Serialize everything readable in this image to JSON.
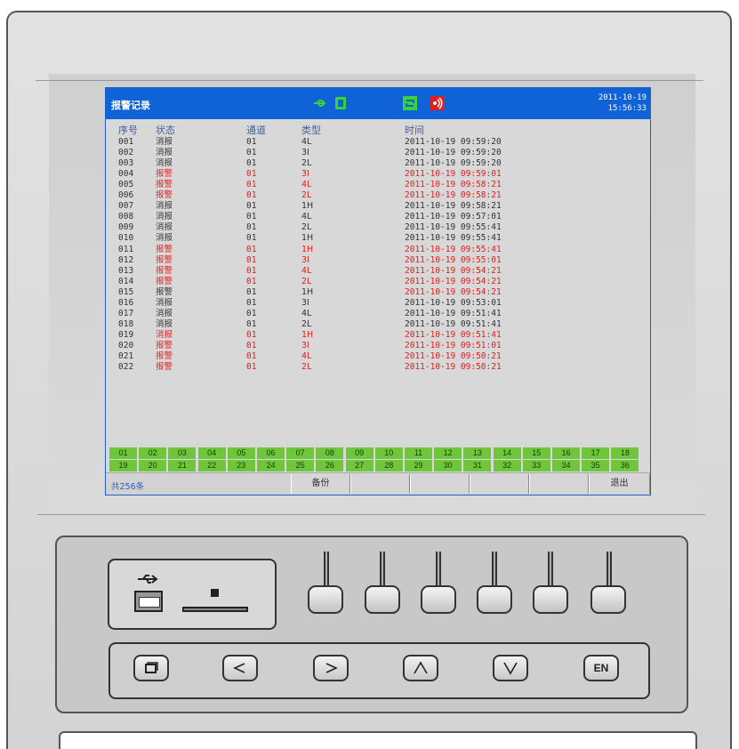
{
  "screen": {
    "title": "报警记录",
    "date": "2011-10-19",
    "time": "15:56:33",
    "headers": {
      "no": "序号",
      "status": "状态",
      "channel": "通道",
      "type": "类型",
      "time": "时间"
    },
    "rows": [
      {
        "no": "001",
        "status": "消报",
        "channel": "01",
        "type": "4L",
        "time": "2011-10-19 09:59:20",
        "color": "black"
      },
      {
        "no": "002",
        "status": "消报",
        "channel": "01",
        "type": "3I",
        "time": "2011-10-19 09:59:20",
        "color": "black"
      },
      {
        "no": "003",
        "status": "消报",
        "channel": "01",
        "type": "2L",
        "time": "2011-10-19 09:59:20",
        "color": "black"
      },
      {
        "no": "004",
        "status": "报警",
        "channel": "01",
        "type": "3I",
        "time": "2011-10-19 09:59:01",
        "color": "red"
      },
      {
        "no": "005",
        "status": "报警",
        "channel": "01",
        "type": "4L",
        "time": "2011-10-19 09:58:21",
        "color": "red"
      },
      {
        "no": "006",
        "status": "报警",
        "channel": "01",
        "type": "2L",
        "time": "2011-10-19 09:58:21",
        "color": "red"
      },
      {
        "no": "007",
        "status": "消报",
        "channel": "01",
        "type": "1H",
        "time": "2011-10-19 09:58:21",
        "color": "black"
      },
      {
        "no": "008",
        "status": "消报",
        "channel": "01",
        "type": "4L",
        "time": "2011-10-19 09:57:01",
        "color": "black"
      },
      {
        "no": "009",
        "status": "消报",
        "channel": "01",
        "type": "2L",
        "time": "2011-10-19 09:55:41",
        "color": "black"
      },
      {
        "no": "010",
        "status": "消报",
        "channel": "01",
        "type": "1H",
        "time": "2011-10-19 09:55:41",
        "color": "black"
      },
      {
        "no": "011",
        "status": "报警",
        "channel": "01",
        "type": "1H",
        "time": "2011-10-19 09:55:41",
        "color": "red"
      },
      {
        "no": "012",
        "status": "报警",
        "channel": "01",
        "type": "3I",
        "time": "2011-10-19 09:55:01",
        "color": "red"
      },
      {
        "no": "013",
        "status": "报警",
        "channel": "01",
        "type": "4L",
        "time": "2011-10-19 09:54:21",
        "color": "red"
      },
      {
        "no": "014",
        "status": "报警",
        "channel": "01",
        "type": "2L",
        "time": "2011-10-19 09:54:21",
        "color": "red"
      },
      {
        "no": "015",
        "status": "报警",
        "channel": "01",
        "type": "1H",
        "time": "2011-10-19 09:54:21",
        "color": "black",
        "timecolor": "red"
      },
      {
        "no": "016",
        "status": "消报",
        "channel": "01",
        "type": "3I",
        "time": "2011-10-19 09:53:01",
        "color": "black"
      },
      {
        "no": "017",
        "status": "消报",
        "channel": "01",
        "type": "4L",
        "time": "2011-10-19 09:51:41",
        "color": "black"
      },
      {
        "no": "018",
        "status": "消报",
        "channel": "01",
        "type": "2L",
        "time": "2011-10-19 09:51:41",
        "color": "black"
      },
      {
        "no": "019",
        "status": "消报",
        "channel": "01",
        "type": "1H",
        "time": "2011-10-19 09:51:41",
        "color": "red"
      },
      {
        "no": "020",
        "status": "报警",
        "channel": "01",
        "type": "3I",
        "time": "2011-10-19 09:51:01",
        "color": "red"
      },
      {
        "no": "021",
        "status": "报警",
        "channel": "01",
        "type": "4L",
        "time": "2011-10-19 09:50:21",
        "color": "red"
      },
      {
        "no": "022",
        "status": "报警",
        "channel": "01",
        "type": "2L",
        "time": "2011-10-19 09:50:21",
        "color": "red"
      }
    ],
    "channels": [
      "01",
      "02",
      "03",
      "04",
      "05",
      "06",
      "07",
      "08",
      "09",
      "10",
      "11",
      "12",
      "13",
      "14",
      "15",
      "16",
      "17",
      "18",
      "19",
      "20",
      "21",
      "22",
      "23",
      "24",
      "25",
      "26",
      "27",
      "28",
      "29",
      "30",
      "31",
      "32",
      "33",
      "34",
      "35",
      "36"
    ],
    "total": "共256条",
    "softkeys": [
      "备份",
      "",
      "",
      "",
      "",
      "退出"
    ]
  },
  "status_icons": [
    "usb-icon",
    "sd-card-icon",
    "sync-icon",
    "alarm-sound-icon"
  ],
  "nav_keys": [
    "window-key",
    "left-key",
    "right-key",
    "up-key",
    "down-key",
    "EN"
  ],
  "colors": {
    "titlebar": "#0f63d6",
    "alarm": "#e02020",
    "channel_green": "#6fc63a",
    "normal": "#333333"
  }
}
